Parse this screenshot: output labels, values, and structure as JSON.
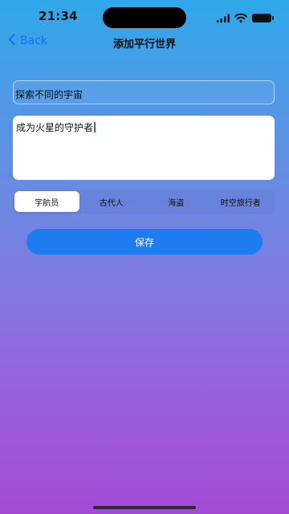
{
  "status": {
    "time": "21:34"
  },
  "nav": {
    "back_label": "Back",
    "title": "添加平行世界"
  },
  "form": {
    "title_value": "探索不同的宇宙",
    "description_value": "成为火星的守护者"
  },
  "segments": [
    {
      "label": "宇航员",
      "selected": true
    },
    {
      "label": "古代人",
      "selected": false
    },
    {
      "label": "海盗",
      "selected": false
    },
    {
      "label": "时空旅行者",
      "selected": false
    }
  ],
  "actions": {
    "save_label": "保存"
  },
  "colors": {
    "accent": "#1c7cf0",
    "gradient_top": "#2fa8ea",
    "gradient_bottom": "#a24bd8"
  }
}
